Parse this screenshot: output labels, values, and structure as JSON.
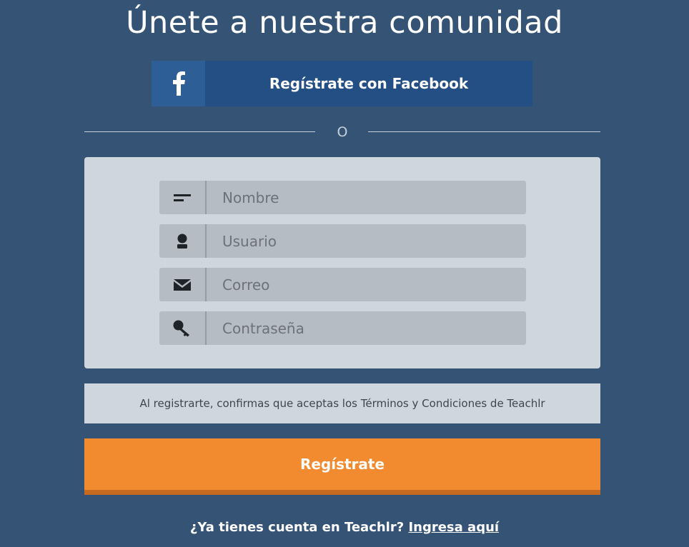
{
  "header": {
    "title": "Únete a nuestra comunidad"
  },
  "facebook": {
    "icon": "facebook-icon",
    "label": "Regístrate con Facebook"
  },
  "divider": {
    "text": "O"
  },
  "form": {
    "fields": [
      {
        "icon": "name-lines-icon",
        "placeholder": "Nombre",
        "value": ""
      },
      {
        "icon": "user-icon",
        "placeholder": "Usuario",
        "value": ""
      },
      {
        "icon": "envelope-icon",
        "placeholder": "Correo",
        "value": ""
      },
      {
        "icon": "key-icon",
        "placeholder": "Contraseña",
        "value": ""
      }
    ]
  },
  "terms": {
    "text": "Al registrarte, confirmas que aceptas los Términos y Condiciones de Teachlr"
  },
  "submit": {
    "label": "Regístrate"
  },
  "login": {
    "prompt": "¿Ya tienes cuenta en Teachlr?",
    "link": "Ingresa aquí"
  },
  "colors": {
    "background": "#355374",
    "facebook": "#234f85",
    "accent": "#f28b2f",
    "panel": "#cfd6de"
  }
}
